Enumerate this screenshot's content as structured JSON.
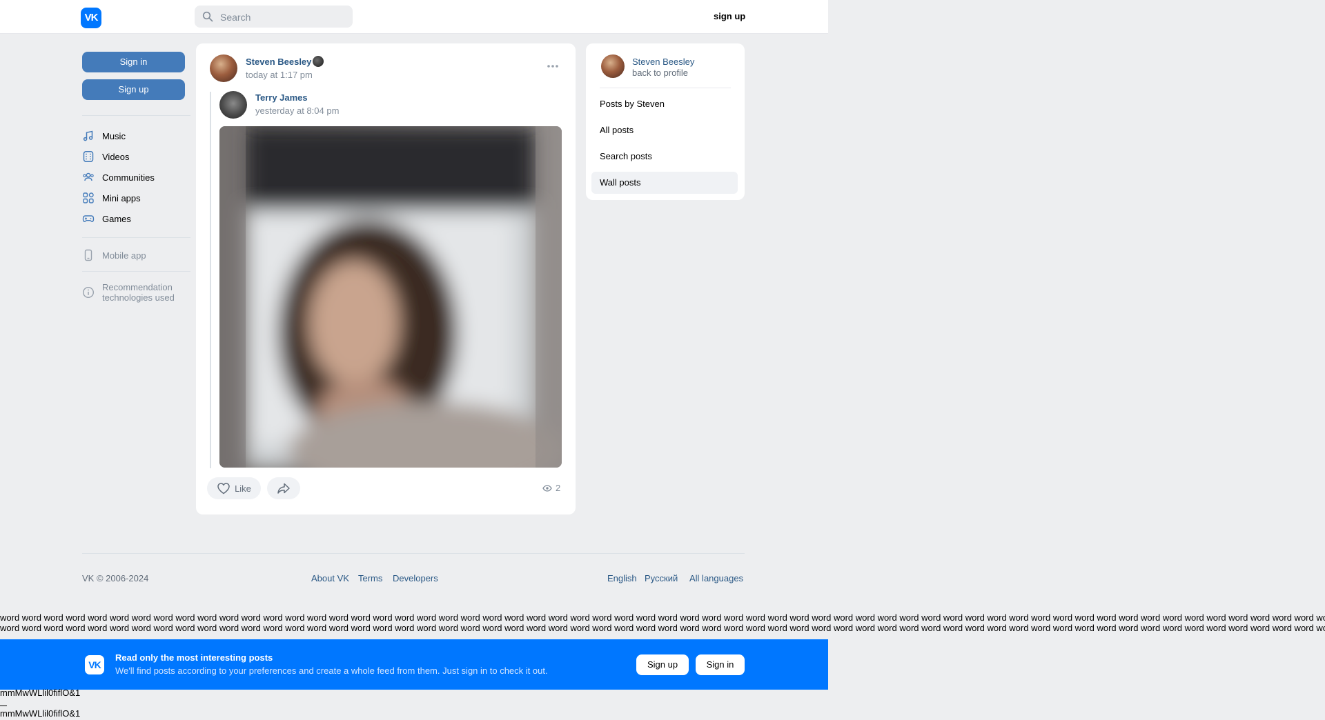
{
  "header": {
    "logo_text": "VK",
    "search_placeholder": "Search",
    "signup_label": "sign up"
  },
  "sidebar": {
    "sign_in_label": "Sign in",
    "sign_up_label": "Sign up",
    "items": [
      {
        "label": "Music",
        "icon": "music-icon"
      },
      {
        "label": "Videos",
        "icon": "video-icon"
      },
      {
        "label": "Communities",
        "icon": "communities-icon"
      },
      {
        "label": "Mini apps",
        "icon": "mini-apps-icon"
      },
      {
        "label": "Games",
        "icon": "gamepad-icon"
      }
    ],
    "mobile_app_label": "Mobile app",
    "recommendation_label_line1": "Recommendation",
    "recommendation_label_line2": "technologies used"
  },
  "post": {
    "author": "Steven Beesley",
    "time": "today at 1:17 pm",
    "repost_author": "Terry James",
    "repost_time": "yesterday at 8:04 pm",
    "like_label": "Like",
    "views_count": "2"
  },
  "side_panel": {
    "profile_name": "Steven Beesley",
    "back_label": "back to profile",
    "items": [
      {
        "label": "Posts by Steven",
        "active": false
      },
      {
        "label": "All posts",
        "active": false
      },
      {
        "label": "Search posts",
        "active": false
      },
      {
        "label": "Wall posts",
        "active": true
      }
    ]
  },
  "footer": {
    "copyright": "VK © 2006-2024",
    "links": [
      "About VK",
      "Terms",
      "Developers"
    ],
    "languages": [
      "English",
      "Русский",
      "All languages"
    ]
  },
  "filler_text": "word word word word word word word word word word word word word word word word word word word word word word word word word word word word word word word word word word word word word word word word word word word word word word word word word word word word word word word word word word word word word word word word word word word word word word",
  "banner": {
    "logo_text": "VK",
    "title": "Read only the most interesting posts",
    "subtitle": "We'll find posts according to your preferences and create a whole feed from them. Just sign in to check it out.",
    "sign_up_label": "Sign up",
    "sign_in_label": "Sign in"
  },
  "font_test_text": "mmMwWLlil0fiflO&1",
  "colors": {
    "accent": "#0077ff",
    "button": "#447bba",
    "link": "#2a5885",
    "background": "#edeef0"
  }
}
